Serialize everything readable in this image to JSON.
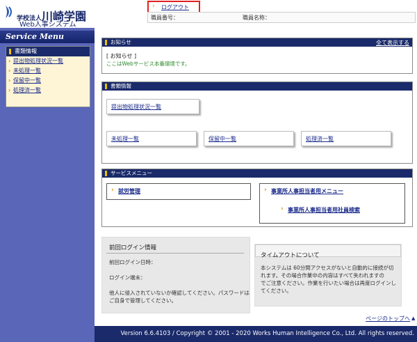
{
  "header": {
    "logo": {
      "prefix": "学校法人",
      "name": "川崎学園",
      "system": "Web人事システム"
    },
    "logout_label": "ログアウト",
    "user_bar": {
      "staff_number_label": "職員番号：",
      "staff_name_label": "職員名称："
    }
  },
  "sidebar": {
    "title": "Service Menu",
    "section_title": "書類情報",
    "items": [
      {
        "label": "提出物処理状況一覧"
      },
      {
        "label": "未処理一覧"
      },
      {
        "label": "保留中一覧"
      },
      {
        "label": "処理済一覧"
      }
    ]
  },
  "notice": {
    "title": "お知らせ",
    "show_all": "全て表示する",
    "heading": "[ お知らせ ]",
    "message": "ここはWebサービス本番環境です。"
  },
  "documents": {
    "title": "書類情報",
    "status_list": "提出物処理状況一覧",
    "unprocessed": "未処理一覧",
    "on_hold": "保留中一覧",
    "processed": "処理済一覧"
  },
  "service_menu": {
    "title": "サービスメニュー",
    "attendance": "就労管理",
    "office_admin_menu": "事業所人事担当者用メニュー",
    "office_admin_search": "事業所人事担当者用社員検索"
  },
  "last_login": {
    "title": "前回ログイン情報",
    "datetime_label": "前回ログイン日時：",
    "terminal_label": "ログイン端末：",
    "note_line1": "他人に侵入されていないか確認してください。パスワードは",
    "note_line2": "ご自身で管理してください。"
  },
  "timeout": {
    "title": "タイムアウトについて",
    "line1": "本システムは 60分間アクセスがないと自動的に接続が切",
    "line2": "れます。その場合作業中の内容はすべて失われますの",
    "line3": "でご注意ください。作業を行いたい場合は再度ログインし",
    "line4": "てください。"
  },
  "page_top": "ページのトップへ",
  "footer": {
    "copyright": "Version 6.6.4103 / Copyright © 2001 - 2020 Works Human Intelligence Co., Ltd. All rights reserved."
  },
  "colors": {
    "navy": "#1a2a6a",
    "sidebar": "#5a66b8",
    "accent_orange": "#e08a00",
    "logout_border": "#e02020"
  }
}
